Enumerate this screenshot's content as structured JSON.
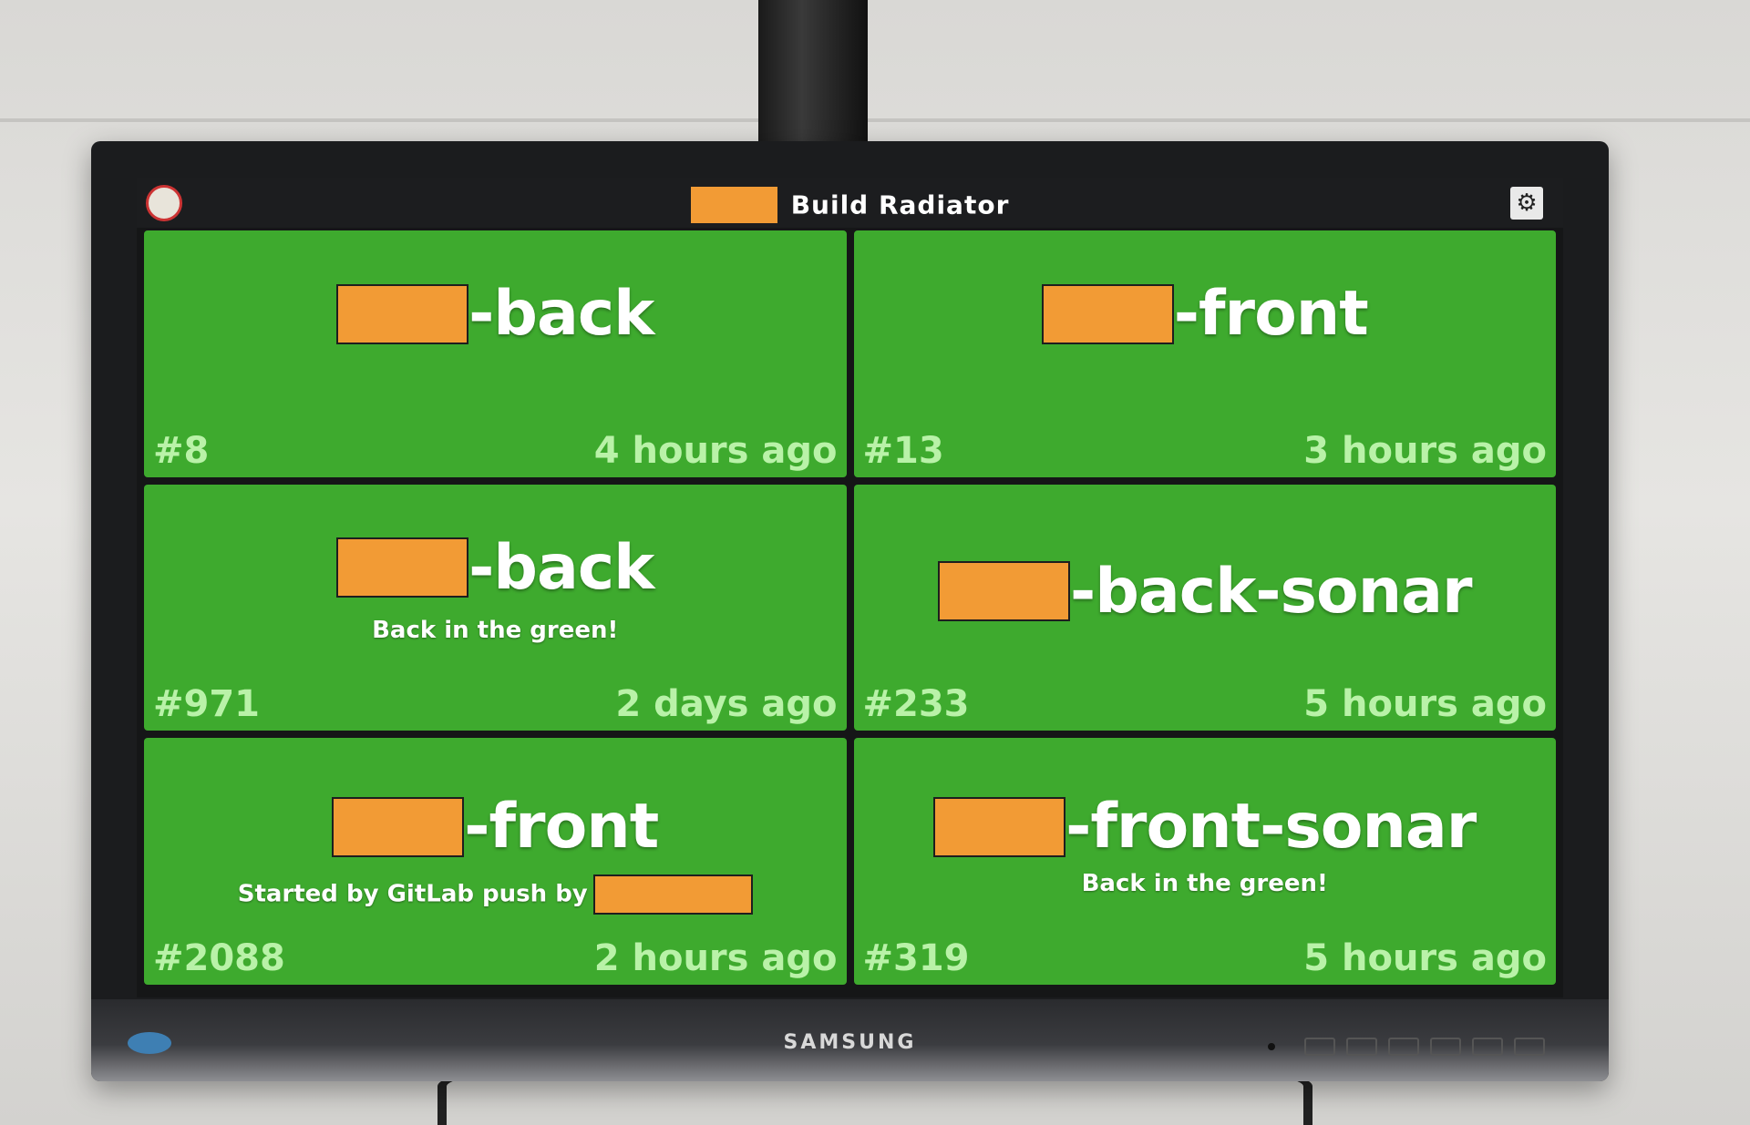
{
  "app": {
    "title": "Build Radiator",
    "settings_icon": "gear-icon",
    "logo_icon": "jenkins-logo-icon"
  },
  "colors": {
    "tile_success": "#3eaa2e",
    "redaction": "#f29b35",
    "meta_text": "#b9f2a8"
  },
  "builds": [
    {
      "name_suffix": "-back",
      "subtitle": "",
      "number": "#8",
      "time": "4 hours ago"
    },
    {
      "name_suffix": "-front",
      "subtitle": "",
      "number": "#13",
      "time": "3 hours ago"
    },
    {
      "name_suffix": "-back",
      "subtitle": "Back in the green!",
      "number": "#971",
      "time": "2 days ago"
    },
    {
      "name_suffix": "-back-sonar",
      "subtitle": "",
      "number": "#233",
      "time": "5 hours ago"
    },
    {
      "name_suffix": "-front",
      "subtitle": "Started by GitLab push by",
      "number": "#2088",
      "time": "2 hours ago"
    },
    {
      "name_suffix": "-front-sonar",
      "subtitle": "Back in the green!",
      "number": "#319",
      "time": "5 hours ago"
    }
  ],
  "monitor": {
    "brand": "SAMSUNG"
  }
}
